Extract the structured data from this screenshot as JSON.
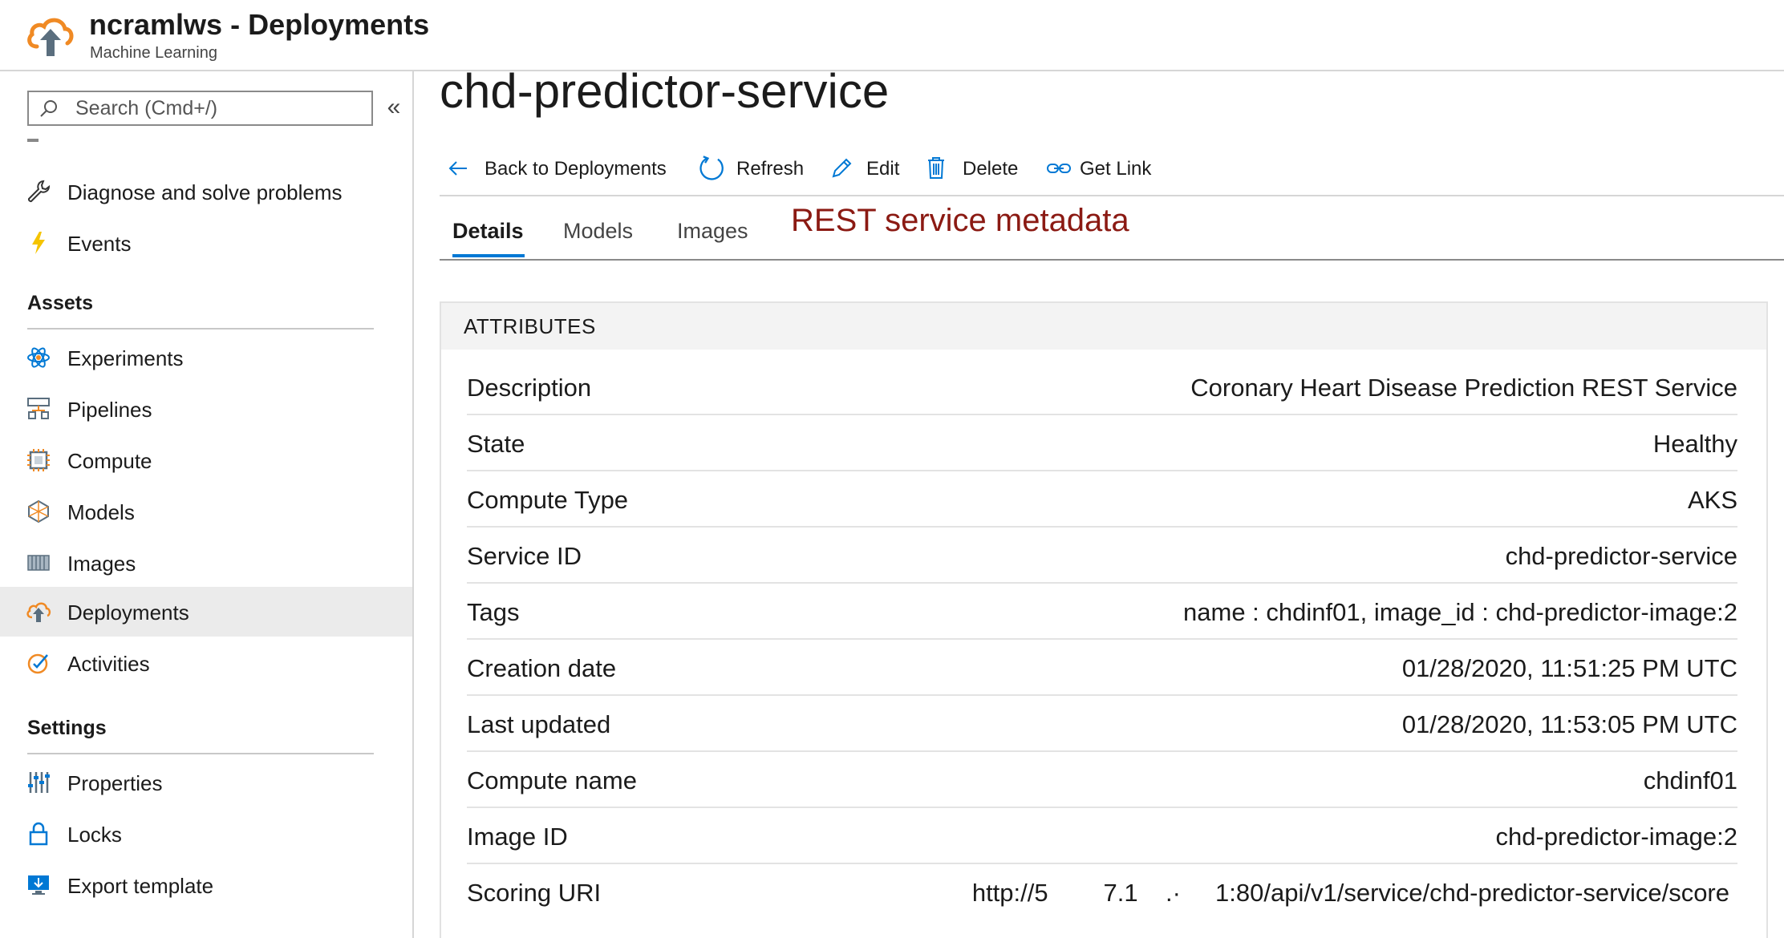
{
  "header": {
    "title": "ncramlws - Deployments",
    "subtitle": "Machine Learning"
  },
  "sidebar": {
    "search_placeholder": "Search (Cmd+/)",
    "collapse_glyph": "«",
    "top_items": [
      {
        "label": "Diagnose and solve problems",
        "icon": "wrench-icon"
      },
      {
        "label": "Events",
        "icon": "lightning-icon"
      }
    ],
    "assets_heading": "Assets",
    "assets_items": [
      {
        "label": "Experiments",
        "icon": "atom-icon"
      },
      {
        "label": "Pipelines",
        "icon": "pipeline-icon"
      },
      {
        "label": "Compute",
        "icon": "chip-icon"
      },
      {
        "label": "Models",
        "icon": "model-icon"
      },
      {
        "label": "Images",
        "icon": "container-icon"
      },
      {
        "label": "Deployments",
        "icon": "cloud-upload-icon",
        "active": true
      },
      {
        "label": "Activities",
        "icon": "check-circle-icon"
      }
    ],
    "settings_heading": "Settings",
    "settings_items": [
      {
        "label": "Properties",
        "icon": "sliders-icon"
      },
      {
        "label": "Locks",
        "icon": "lock-icon"
      },
      {
        "label": "Export template",
        "icon": "monitor-download-icon"
      }
    ]
  },
  "main": {
    "page_title": "chd-predictor-service",
    "toolbar": {
      "back": "Back to Deployments",
      "refresh": "Refresh",
      "edit": "Edit",
      "delete": "Delete",
      "get_link": "Get Link"
    },
    "tabs": [
      "Details",
      "Models",
      "Images"
    ],
    "active_tab": "Details",
    "annotation": "REST service metadata",
    "panel_heading": "ATTRIBUTES",
    "attributes": [
      {
        "key": "Description",
        "value": "Coronary Heart Disease Prediction REST Service"
      },
      {
        "key": "State",
        "value": "Healthy"
      },
      {
        "key": "Compute Type",
        "value": "AKS"
      },
      {
        "key": "Service ID",
        "value": "chd-predictor-service"
      },
      {
        "key": "Tags",
        "value": "name : chdinf01, image_id : chd-predictor-image:2"
      },
      {
        "key": "Creation date",
        "value": "01/28/2020, 11:51:25 PM UTC"
      },
      {
        "key": "Last updated",
        "value": "01/28/2020, 11:53:05 PM UTC"
      },
      {
        "key": "Compute name",
        "value": "chdinf01"
      },
      {
        "key": "Image ID",
        "value": "chd-predictor-image:2"
      },
      {
        "key": "Scoring URI",
        "value": "http://5        7.1    .·     1:80/api/v1/service/chd-predictor-service/score"
      }
    ]
  },
  "colors": {
    "accent": "#0078d4",
    "annotation": "#8b1a13",
    "active_nav_bg": "#ebebeb"
  }
}
